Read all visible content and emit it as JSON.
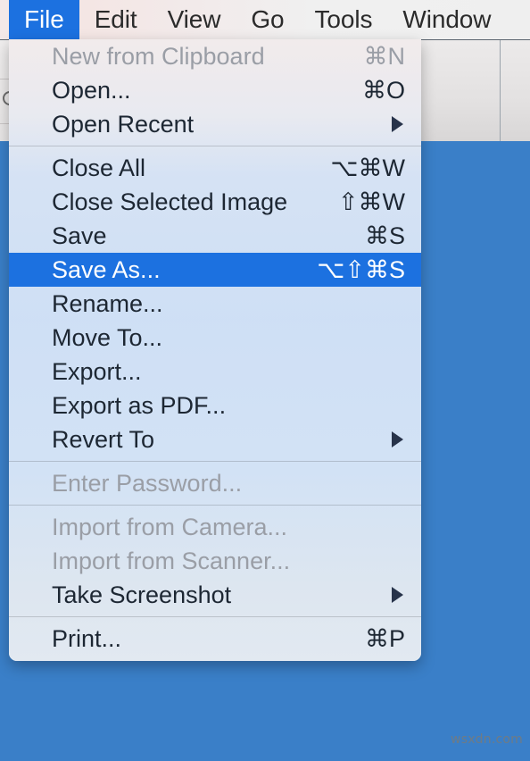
{
  "menubar": {
    "items": [
      {
        "label": "File",
        "active": true
      },
      {
        "label": "Edit",
        "active": false
      },
      {
        "label": "View",
        "active": false
      },
      {
        "label": "Go",
        "active": false
      },
      {
        "label": "Tools",
        "active": false
      },
      {
        "label": "Window",
        "active": false
      }
    ]
  },
  "window": {
    "search_icon": "search-icon"
  },
  "file_menu": {
    "title": "File",
    "groups": [
      {
        "items": [
          {
            "label": "New from Clipboard",
            "shortcut": "⌘N",
            "disabled": true,
            "highlight": false,
            "submenu": false
          },
          {
            "label": "Open...",
            "shortcut": "⌘O",
            "disabled": false,
            "highlight": false,
            "submenu": false
          },
          {
            "label": "Open Recent",
            "shortcut": "",
            "disabled": false,
            "highlight": false,
            "submenu": true
          }
        ]
      },
      {
        "items": [
          {
            "label": "Close All",
            "shortcut": "⌥⌘W",
            "disabled": false,
            "highlight": false,
            "submenu": false
          },
          {
            "label": "Close Selected Image",
            "shortcut": "⇧⌘W",
            "disabled": false,
            "highlight": false,
            "submenu": false
          },
          {
            "label": "Save",
            "shortcut": "⌘S",
            "disabled": false,
            "highlight": false,
            "submenu": false
          },
          {
            "label": "Save As...",
            "shortcut": "⌥⇧⌘S",
            "disabled": false,
            "highlight": true,
            "submenu": false
          },
          {
            "label": "Rename...",
            "shortcut": "",
            "disabled": false,
            "highlight": false,
            "submenu": false
          },
          {
            "label": "Move To...",
            "shortcut": "",
            "disabled": false,
            "highlight": false,
            "submenu": false
          },
          {
            "label": "Export...",
            "shortcut": "",
            "disabled": false,
            "highlight": false,
            "submenu": false
          },
          {
            "label": "Export as PDF...",
            "shortcut": "",
            "disabled": false,
            "highlight": false,
            "submenu": false
          },
          {
            "label": "Revert To",
            "shortcut": "",
            "disabled": false,
            "highlight": false,
            "submenu": true
          }
        ]
      },
      {
        "items": [
          {
            "label": "Enter Password...",
            "shortcut": "",
            "disabled": true,
            "highlight": false,
            "submenu": false
          }
        ]
      },
      {
        "items": [
          {
            "label": "Import from Camera...",
            "shortcut": "",
            "disabled": true,
            "highlight": false,
            "submenu": false
          },
          {
            "label": "Import from Scanner...",
            "shortcut": "",
            "disabled": true,
            "highlight": false,
            "submenu": false
          },
          {
            "label": "Take Screenshot",
            "shortcut": "",
            "disabled": false,
            "highlight": false,
            "submenu": true
          }
        ]
      },
      {
        "items": [
          {
            "label": "Print...",
            "shortcut": "⌘P",
            "disabled": false,
            "highlight": false,
            "submenu": false
          }
        ]
      }
    ]
  },
  "watermark": {
    "text": "wsxdn.com"
  },
  "colors": {
    "accent": "#1c71e0",
    "menu_bg": "#d6e2f4",
    "desktop_blue": "#3a7fc8",
    "disabled_text": "#9a9ea6"
  }
}
